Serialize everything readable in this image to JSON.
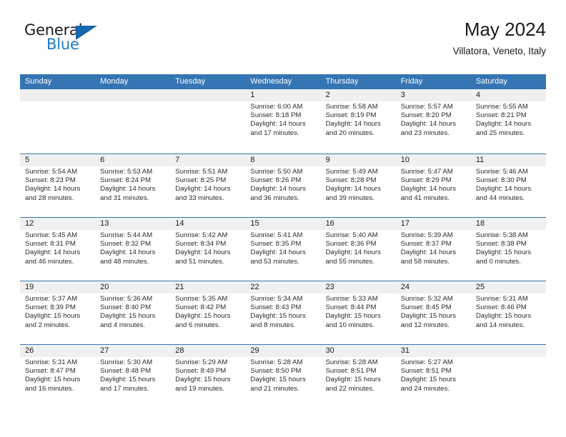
{
  "brand": {
    "line1": "General",
    "line2": "Blue",
    "accent_color": "#1f7ac4",
    "triangle_color": "#1767ad"
  },
  "header": {
    "title": "May 2024",
    "subtitle": "Villatora, Veneto, Italy"
  },
  "theme": {
    "header_blue": "#3575b4",
    "band_gray": "#f0f0f0",
    "text": "#1a1a1a"
  },
  "weekdays": [
    "Sunday",
    "Monday",
    "Tuesday",
    "Wednesday",
    "Thursday",
    "Friday",
    "Saturday"
  ],
  "weeks": [
    [
      {
        "day": "",
        "sunrise": "",
        "sunset": "",
        "daylight1": "",
        "daylight2": ""
      },
      {
        "day": "",
        "sunrise": "",
        "sunset": "",
        "daylight1": "",
        "daylight2": ""
      },
      {
        "day": "",
        "sunrise": "",
        "sunset": "",
        "daylight1": "",
        "daylight2": ""
      },
      {
        "day": "1",
        "sunrise": "Sunrise: 6:00 AM",
        "sunset": "Sunset: 8:18 PM",
        "daylight1": "Daylight: 14 hours",
        "daylight2": "and 17 minutes."
      },
      {
        "day": "2",
        "sunrise": "Sunrise: 5:58 AM",
        "sunset": "Sunset: 8:19 PM",
        "daylight1": "Daylight: 14 hours",
        "daylight2": "and 20 minutes."
      },
      {
        "day": "3",
        "sunrise": "Sunrise: 5:57 AM",
        "sunset": "Sunset: 8:20 PM",
        "daylight1": "Daylight: 14 hours",
        "daylight2": "and 23 minutes."
      },
      {
        "day": "4",
        "sunrise": "Sunrise: 5:55 AM",
        "sunset": "Sunset: 8:21 PM",
        "daylight1": "Daylight: 14 hours",
        "daylight2": "and 25 minutes."
      }
    ],
    [
      {
        "day": "5",
        "sunrise": "Sunrise: 5:54 AM",
        "sunset": "Sunset: 8:23 PM",
        "daylight1": "Daylight: 14 hours",
        "daylight2": "and 28 minutes."
      },
      {
        "day": "6",
        "sunrise": "Sunrise: 5:53 AM",
        "sunset": "Sunset: 8:24 PM",
        "daylight1": "Daylight: 14 hours",
        "daylight2": "and 31 minutes."
      },
      {
        "day": "7",
        "sunrise": "Sunrise: 5:51 AM",
        "sunset": "Sunset: 8:25 PM",
        "daylight1": "Daylight: 14 hours",
        "daylight2": "and 33 minutes."
      },
      {
        "day": "8",
        "sunrise": "Sunrise: 5:50 AM",
        "sunset": "Sunset: 8:26 PM",
        "daylight1": "Daylight: 14 hours",
        "daylight2": "and 36 minutes."
      },
      {
        "day": "9",
        "sunrise": "Sunrise: 5:49 AM",
        "sunset": "Sunset: 8:28 PM",
        "daylight1": "Daylight: 14 hours",
        "daylight2": "and 39 minutes."
      },
      {
        "day": "10",
        "sunrise": "Sunrise: 5:47 AM",
        "sunset": "Sunset: 8:29 PM",
        "daylight1": "Daylight: 14 hours",
        "daylight2": "and 41 minutes."
      },
      {
        "day": "11",
        "sunrise": "Sunrise: 5:46 AM",
        "sunset": "Sunset: 8:30 PM",
        "daylight1": "Daylight: 14 hours",
        "daylight2": "and 44 minutes."
      }
    ],
    [
      {
        "day": "12",
        "sunrise": "Sunrise: 5:45 AM",
        "sunset": "Sunset: 8:31 PM",
        "daylight1": "Daylight: 14 hours",
        "daylight2": "and 46 minutes."
      },
      {
        "day": "13",
        "sunrise": "Sunrise: 5:44 AM",
        "sunset": "Sunset: 8:32 PM",
        "daylight1": "Daylight: 14 hours",
        "daylight2": "and 48 minutes."
      },
      {
        "day": "14",
        "sunrise": "Sunrise: 5:42 AM",
        "sunset": "Sunset: 8:34 PM",
        "daylight1": "Daylight: 14 hours",
        "daylight2": "and 51 minutes."
      },
      {
        "day": "15",
        "sunrise": "Sunrise: 5:41 AM",
        "sunset": "Sunset: 8:35 PM",
        "daylight1": "Daylight: 14 hours",
        "daylight2": "and 53 minutes."
      },
      {
        "day": "16",
        "sunrise": "Sunrise: 5:40 AM",
        "sunset": "Sunset: 8:36 PM",
        "daylight1": "Daylight: 14 hours",
        "daylight2": "and 55 minutes."
      },
      {
        "day": "17",
        "sunrise": "Sunrise: 5:39 AM",
        "sunset": "Sunset: 8:37 PM",
        "daylight1": "Daylight: 14 hours",
        "daylight2": "and 58 minutes."
      },
      {
        "day": "18",
        "sunrise": "Sunrise: 5:38 AM",
        "sunset": "Sunset: 8:38 PM",
        "daylight1": "Daylight: 15 hours",
        "daylight2": "and 0 minutes."
      }
    ],
    [
      {
        "day": "19",
        "sunrise": "Sunrise: 5:37 AM",
        "sunset": "Sunset: 8:39 PM",
        "daylight1": "Daylight: 15 hours",
        "daylight2": "and 2 minutes."
      },
      {
        "day": "20",
        "sunrise": "Sunrise: 5:36 AM",
        "sunset": "Sunset: 8:40 PM",
        "daylight1": "Daylight: 15 hours",
        "daylight2": "and 4 minutes."
      },
      {
        "day": "21",
        "sunrise": "Sunrise: 5:35 AM",
        "sunset": "Sunset: 8:42 PM",
        "daylight1": "Daylight: 15 hours",
        "daylight2": "and 6 minutes."
      },
      {
        "day": "22",
        "sunrise": "Sunrise: 5:34 AM",
        "sunset": "Sunset: 8:43 PM",
        "daylight1": "Daylight: 15 hours",
        "daylight2": "and 8 minutes."
      },
      {
        "day": "23",
        "sunrise": "Sunrise: 5:33 AM",
        "sunset": "Sunset: 8:44 PM",
        "daylight1": "Daylight: 15 hours",
        "daylight2": "and 10 minutes."
      },
      {
        "day": "24",
        "sunrise": "Sunrise: 5:32 AM",
        "sunset": "Sunset: 8:45 PM",
        "daylight1": "Daylight: 15 hours",
        "daylight2": "and 12 minutes."
      },
      {
        "day": "25",
        "sunrise": "Sunrise: 5:31 AM",
        "sunset": "Sunset: 8:46 PM",
        "daylight1": "Daylight: 15 hours",
        "daylight2": "and 14 minutes."
      }
    ],
    [
      {
        "day": "26",
        "sunrise": "Sunrise: 5:31 AM",
        "sunset": "Sunset: 8:47 PM",
        "daylight1": "Daylight: 15 hours",
        "daylight2": "and 16 minutes."
      },
      {
        "day": "27",
        "sunrise": "Sunrise: 5:30 AM",
        "sunset": "Sunset: 8:48 PM",
        "daylight1": "Daylight: 15 hours",
        "daylight2": "and 17 minutes."
      },
      {
        "day": "28",
        "sunrise": "Sunrise: 5:29 AM",
        "sunset": "Sunset: 8:49 PM",
        "daylight1": "Daylight: 15 hours",
        "daylight2": "and 19 minutes."
      },
      {
        "day": "29",
        "sunrise": "Sunrise: 5:28 AM",
        "sunset": "Sunset: 8:50 PM",
        "daylight1": "Daylight: 15 hours",
        "daylight2": "and 21 minutes."
      },
      {
        "day": "30",
        "sunrise": "Sunrise: 5:28 AM",
        "sunset": "Sunset: 8:51 PM",
        "daylight1": "Daylight: 15 hours",
        "daylight2": "and 22 minutes."
      },
      {
        "day": "31",
        "sunrise": "Sunrise: 5:27 AM",
        "sunset": "Sunset: 8:51 PM",
        "daylight1": "Daylight: 15 hours",
        "daylight2": "and 24 minutes."
      },
      {
        "day": "",
        "sunrise": "",
        "sunset": "",
        "daylight1": "",
        "daylight2": ""
      }
    ]
  ]
}
